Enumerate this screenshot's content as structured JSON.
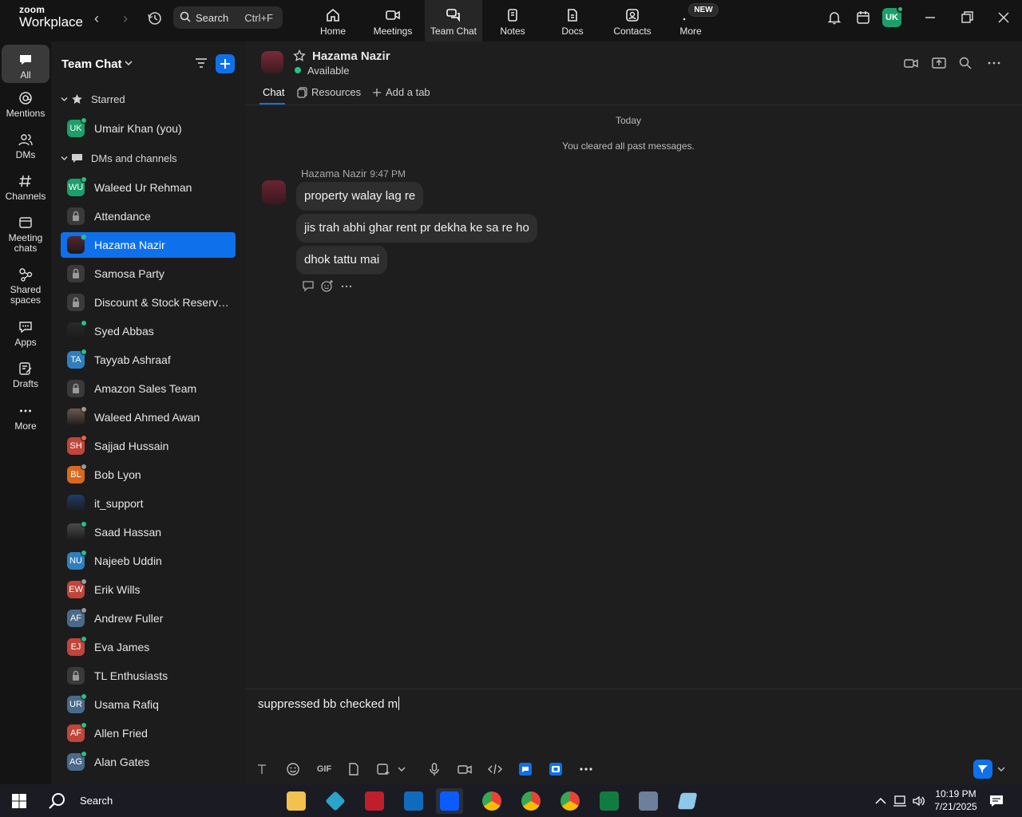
{
  "app": {
    "logo_top": "zoom",
    "logo_bottom": "Workplace"
  },
  "search": {
    "label": "Search",
    "shortcut": "Ctrl+F"
  },
  "top_tabs": [
    {
      "label": "Home",
      "icon": "home-icon"
    },
    {
      "label": "Meetings",
      "icon": "video-camera-icon"
    },
    {
      "label": "Team Chat",
      "icon": "chat-bubbles-icon"
    },
    {
      "label": "Notes",
      "icon": "notes-icon"
    },
    {
      "label": "Docs",
      "icon": "docs-icon"
    },
    {
      "label": "Contacts",
      "icon": "contacts-icon"
    },
    {
      "label": "More",
      "icon": "more-dots-icon"
    }
  ],
  "active_top_tab": "Team Chat",
  "new_badge": "NEW",
  "user_avatar": "UK",
  "rail": [
    {
      "label": "All",
      "icon": "chat-icon"
    },
    {
      "label": "Mentions",
      "icon": "at-icon"
    },
    {
      "label": "DMs",
      "icon": "people-icon"
    },
    {
      "label": "Channels",
      "icon": "hash-icon"
    },
    {
      "label_1": "Meeting",
      "label_2": "chats",
      "icon": "calendar-chat-icon"
    },
    {
      "label_1": "Shared",
      "label_2": "spaces",
      "icon": "share-nodes-icon"
    },
    {
      "label": "Apps",
      "icon": "apps-icon"
    },
    {
      "label": "Drafts",
      "icon": "drafts-icon"
    },
    {
      "label": "More",
      "icon": "ellipsis-icon"
    }
  ],
  "sidebar": {
    "title": "Team Chat",
    "starred_label": "Starred",
    "starred": [
      {
        "initials": "UK",
        "name": "Umair Khan (you)",
        "color": "#1d9e6b",
        "presence": "#26c281"
      }
    ],
    "dms_label": "DMs and channels",
    "items": [
      {
        "initials": "WU",
        "name": "Waleed Ur Rehman",
        "color": "#1d9e6b",
        "presence": "#26c281",
        "kind": "person"
      },
      {
        "initials": "",
        "name": "Attendance",
        "color": "#3a3a3a",
        "presence": "",
        "kind": "locked-channel"
      },
      {
        "initials": "",
        "name": "Hazama Nazir",
        "color": "#5a2530",
        "presence": "#26c281",
        "kind": "photo",
        "selected": true
      },
      {
        "initials": "",
        "name": "Samosa Party",
        "color": "#3a3a3a",
        "presence": "",
        "kind": "locked-channel"
      },
      {
        "initials": "",
        "name": "Discount & Stock Reservati...",
        "color": "#3a3a3a",
        "presence": "",
        "kind": "locked-channel"
      },
      {
        "initials": "",
        "name": "Syed Abbas",
        "color": "#2a2a2a",
        "presence": "#26c281",
        "kind": "photo"
      },
      {
        "initials": "TA",
        "name": "Tayyab Ashraaf",
        "color": "#2f7fbf",
        "presence": "#26c281",
        "kind": "person"
      },
      {
        "initials": "",
        "name": "Amazon Sales Team",
        "color": "#3a3a3a",
        "presence": "",
        "kind": "locked-channel"
      },
      {
        "initials": "",
        "name": "Waleed Ahmed Awan",
        "color": "#6b5a50",
        "presence": "#9a9a9a",
        "kind": "photo"
      },
      {
        "initials": "SH",
        "name": "Sajjad Hussain",
        "color": "#c0453a",
        "presence": "#e8663d",
        "kind": "person"
      },
      {
        "initials": "BL",
        "name": "Bob Lyon",
        "color": "#d9681f",
        "presence": "#9a9a9a",
        "kind": "person"
      },
      {
        "initials": "",
        "name": "it_support",
        "color": "#1f3b66",
        "presence": "",
        "kind": "photo"
      },
      {
        "initials": "",
        "name": "Saad Hassan",
        "color": "#4a4a4a",
        "presence": "#26c281",
        "kind": "photo"
      },
      {
        "initials": "NU",
        "name": "Najeeb Uddin",
        "color": "#2f7fbf",
        "presence": "#26c281",
        "kind": "person"
      },
      {
        "initials": "EW",
        "name": "Erik Wills",
        "color": "#c0453a",
        "presence": "#9a9a9a",
        "kind": "person"
      },
      {
        "initials": "AF",
        "name": "Andrew Fuller",
        "color": "#4a6a8a",
        "presence": "#9a9a9a",
        "kind": "person"
      },
      {
        "initials": "EJ",
        "name": "Eva James",
        "color": "#c0453a",
        "presence": "#26c281",
        "kind": "person"
      },
      {
        "initials": "",
        "name": "TL Enthusiasts",
        "color": "#3a3a3a",
        "presence": "",
        "kind": "locked-channel"
      },
      {
        "initials": "UR",
        "name": "Usama Rafiq",
        "color": "#4a6a8a",
        "presence": "#26c281",
        "kind": "person"
      },
      {
        "initials": "AF",
        "name": "Allen Fried",
        "color": "#c0453a",
        "presence": "#26c281",
        "kind": "person"
      },
      {
        "initials": "AG",
        "name": "Alan Gates",
        "color": "#4a6a8a",
        "presence": "#26c281",
        "kind": "person"
      }
    ]
  },
  "chat": {
    "name": "Hazama Nazir",
    "status": "Available",
    "tabs": [
      {
        "label": "Chat"
      },
      {
        "label": "Resources"
      },
      {
        "label": "Add a tab"
      }
    ],
    "day": "Today",
    "system_note": "You cleared all past messages.",
    "sender": "Hazama Nazir",
    "time": "9:47 PM",
    "messages": [
      "property walay lag re",
      "jis trah abhi ghar rent pr dekha ke sa re ho",
      "dhok tattu mai"
    ],
    "composer_text": "suppressed bb checked m",
    "gif_label": "GIF"
  },
  "taskbar": {
    "search_label": "Search",
    "time": "10:19 PM",
    "date": "7/21/2025"
  },
  "colors": {
    "accent": "#0e71eb",
    "online": "#26c281"
  }
}
